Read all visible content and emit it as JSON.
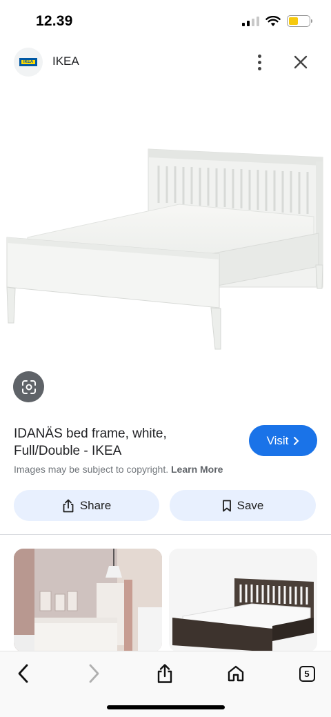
{
  "status_bar": {
    "time": "12.39",
    "icons": [
      "signal-icon",
      "wifi-icon",
      "battery-icon"
    ],
    "battery_color": "#f6c90e"
  },
  "header": {
    "site_name": "IKEA",
    "logo_text": "IKEA",
    "icons": [
      "more-vert-icon",
      "close-icon"
    ]
  },
  "product": {
    "title_line1": "IDANÄS bed frame, white,",
    "title_line2": "Full/Double - IKEA",
    "visit_label": "Visit",
    "visit_color": "#1a73e8",
    "copyright_text": "Images may be subject to copyright.",
    "learn_more_label": "Learn More"
  },
  "actions": {
    "share_label": "Share",
    "save_label": "Save",
    "button_bg": "#e8f0fe"
  },
  "toolbar": {
    "tabs_count": "5",
    "icons": [
      "back-icon",
      "forward-icon",
      "share-icon",
      "home-icon",
      "tabs-icon"
    ]
  }
}
